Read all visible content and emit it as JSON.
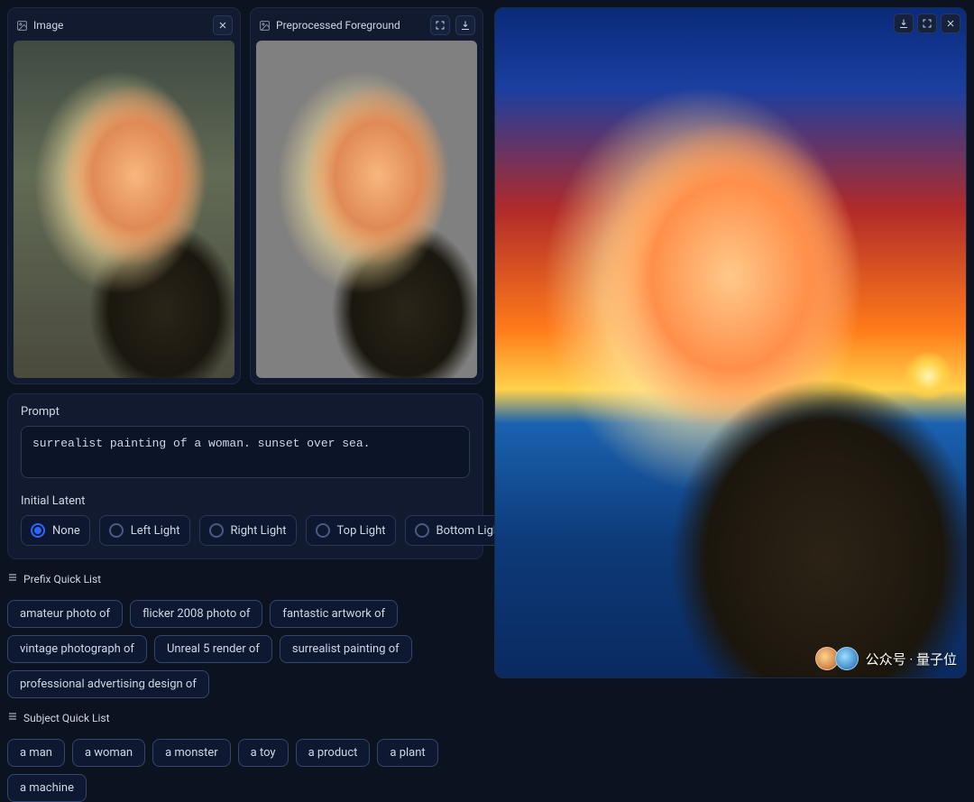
{
  "panels": {
    "source": {
      "title": "Image"
    },
    "foreground": {
      "title": "Preprocessed Foreground"
    }
  },
  "prompt": {
    "label": "Prompt",
    "value": "surrealist painting of a woman. sunset over sea."
  },
  "latent": {
    "label": "Initial Latent",
    "options": [
      "None",
      "Left Light",
      "Right Light",
      "Top Light",
      "Bottom Light"
    ],
    "selected": "None"
  },
  "prefix_quick_list": {
    "label": "Prefix Quick List",
    "items": [
      "amateur photo of",
      "flicker 2008 photo of",
      "fantastic artwork of",
      "vintage photograph of",
      "Unreal 5 render of",
      "surrealist painting of",
      "professional advertising design of"
    ]
  },
  "subject_quick_list": {
    "label": "Subject Quick List",
    "items": [
      "a man",
      "a woman",
      "a monster",
      "a toy",
      "a product",
      "a plant",
      "a machine"
    ]
  },
  "watermark": {
    "text": "公众号 · 量子位"
  }
}
